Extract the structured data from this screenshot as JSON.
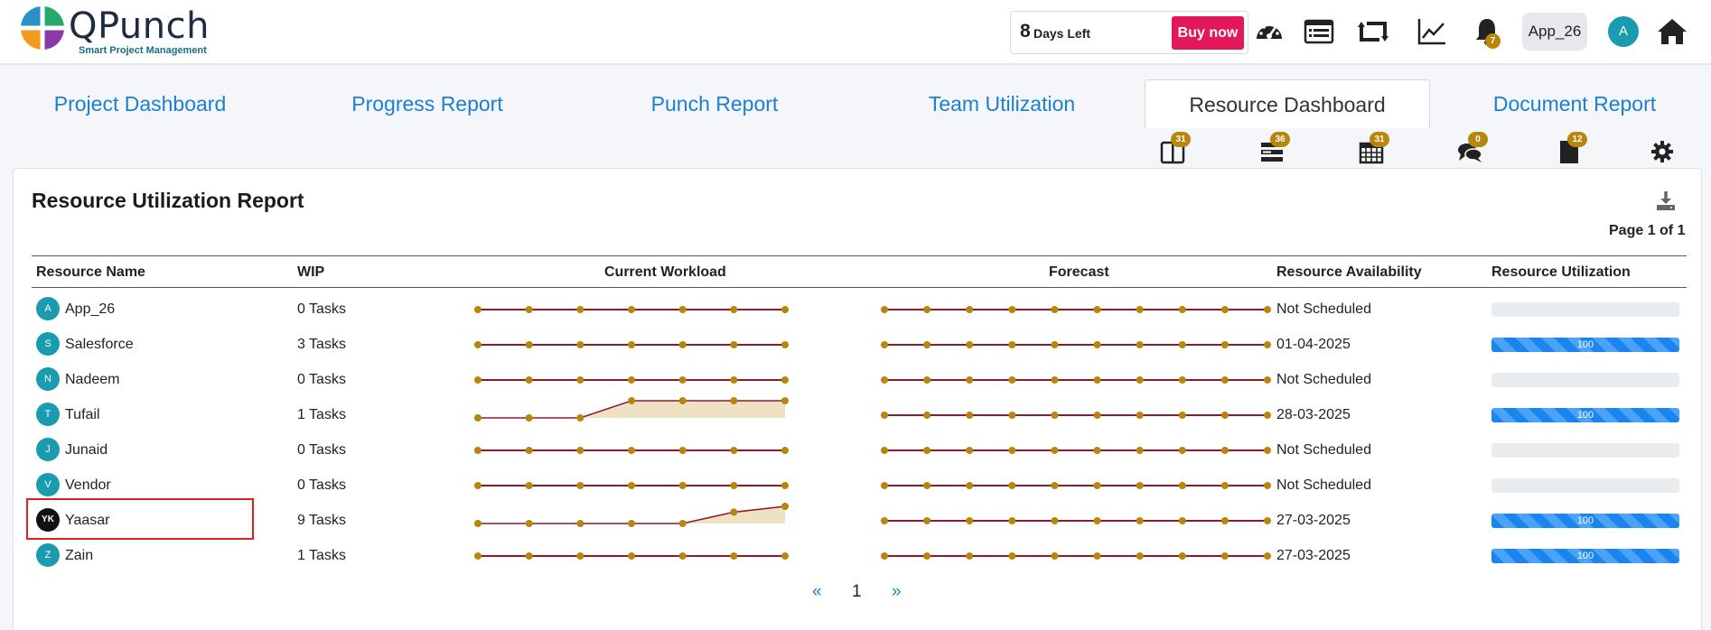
{
  "header": {
    "logo_text": "QPunch",
    "logo_tagline": "Smart Project Management",
    "trial_days": "8",
    "trial_label": "Days Left",
    "buy_label": "Buy now",
    "notification_count": "7",
    "user_label": "App_26",
    "avatar_initial": "A",
    "icons": [
      "dashboard-icon",
      "list-icon",
      "retweet-icon",
      "chart-line-icon",
      "bell-icon",
      "home-icon"
    ]
  },
  "tabs": [
    "Project Dashboard",
    "Progress Report",
    "Punch Report",
    "Team Utilization",
    "Resource Dashboard",
    "Document Report"
  ],
  "active_tab": "Resource Dashboard",
  "subtoolbar": [
    {
      "icon": "columns-icon",
      "badge": "31"
    },
    {
      "icon": "tasks-icon",
      "badge": "36"
    },
    {
      "icon": "calendar-icon",
      "badge": "31"
    },
    {
      "icon": "comments-icon",
      "badge": "0"
    },
    {
      "icon": "file-icon",
      "badge": "12"
    },
    {
      "icon": "gear-icon",
      "badge": ""
    }
  ],
  "report": {
    "title": "Resource Utilization Report",
    "page_info": "Page 1 of 1",
    "columns": [
      "Resource Name",
      "WIP",
      "Current Workload",
      "Forecast",
      "Resource Availability",
      "Resource Utilization"
    ]
  },
  "rows": [
    {
      "initial": "A",
      "name": "App_26",
      "wip": "0 Tasks",
      "workload": [
        0,
        0,
        0,
        0,
        0,
        0,
        0
      ],
      "forecast": [
        0,
        0,
        0,
        0,
        0,
        0,
        0,
        0,
        0,
        0
      ],
      "availability": "Not Scheduled",
      "utilization": null
    },
    {
      "initial": "S",
      "name": "Salesforce",
      "wip": "3 Tasks",
      "workload": [
        0,
        0,
        0,
        0,
        0,
        0,
        0
      ],
      "forecast": [
        0,
        0,
        0,
        0,
        0,
        0,
        0,
        0,
        0,
        0
      ],
      "availability": "01-04-2025",
      "utilization": 100
    },
    {
      "initial": "N",
      "name": "Nadeem",
      "wip": "0 Tasks",
      "workload": [
        0,
        0,
        0,
        0,
        0,
        0,
        0
      ],
      "forecast": [
        0,
        0,
        0,
        0,
        0,
        0,
        0,
        0,
        0,
        0
      ],
      "availability": "Not Scheduled",
      "utilization": null
    },
    {
      "initial": "T",
      "name": "Tufail",
      "wip": "1 Tasks",
      "workload": [
        0,
        0,
        0,
        1,
        1,
        1,
        1
      ],
      "forecast": [
        0,
        0,
        0,
        0,
        0,
        0,
        0,
        0,
        0,
        0
      ],
      "availability": "28-03-2025",
      "utilization": 100
    },
    {
      "initial": "J",
      "name": "Junaid",
      "wip": "0 Tasks",
      "workload": [
        0,
        0,
        0,
        0,
        0,
        0,
        0
      ],
      "forecast": [
        0,
        0,
        0,
        0,
        0,
        0,
        0,
        0,
        0,
        0
      ],
      "availability": "Not Scheduled",
      "utilization": null
    },
    {
      "initial": "V",
      "name": "Vendor",
      "wip": "0 Tasks",
      "workload": [
        0,
        0,
        0,
        0,
        0,
        0,
        0
      ],
      "forecast": [
        0,
        0,
        0,
        0,
        0,
        0,
        0,
        0,
        0,
        0
      ],
      "availability": "Not Scheduled",
      "utilization": null
    },
    {
      "initial": "YK",
      "name": "Yaasar",
      "wip": "9 Tasks",
      "workload": [
        0,
        0,
        0,
        0,
        0,
        0.6,
        1
      ],
      "forecast": [
        0,
        0,
        0,
        0,
        0,
        0,
        0,
        0,
        0,
        0
      ],
      "availability": "27-03-2025",
      "utilization": 100
    },
    {
      "initial": "Z",
      "name": "Zain",
      "wip": "1 Tasks",
      "workload": [
        0,
        0,
        0,
        0,
        0,
        0,
        0
      ],
      "forecast": [
        0,
        0,
        0,
        0,
        0,
        0,
        0,
        0,
        0,
        0
      ],
      "availability": "27-03-2025",
      "utilization": 100
    }
  ],
  "pagination": {
    "prev": "«",
    "current": "1",
    "next": "»"
  },
  "colors": {
    "accent": "#1a7fd6",
    "buy": "#e2185a",
    "spark_line": "#8b1a2b",
    "spark_dot": "#b8860b",
    "spark_fill": "#efe2c4",
    "avatar": "#1a9bb0"
  }
}
